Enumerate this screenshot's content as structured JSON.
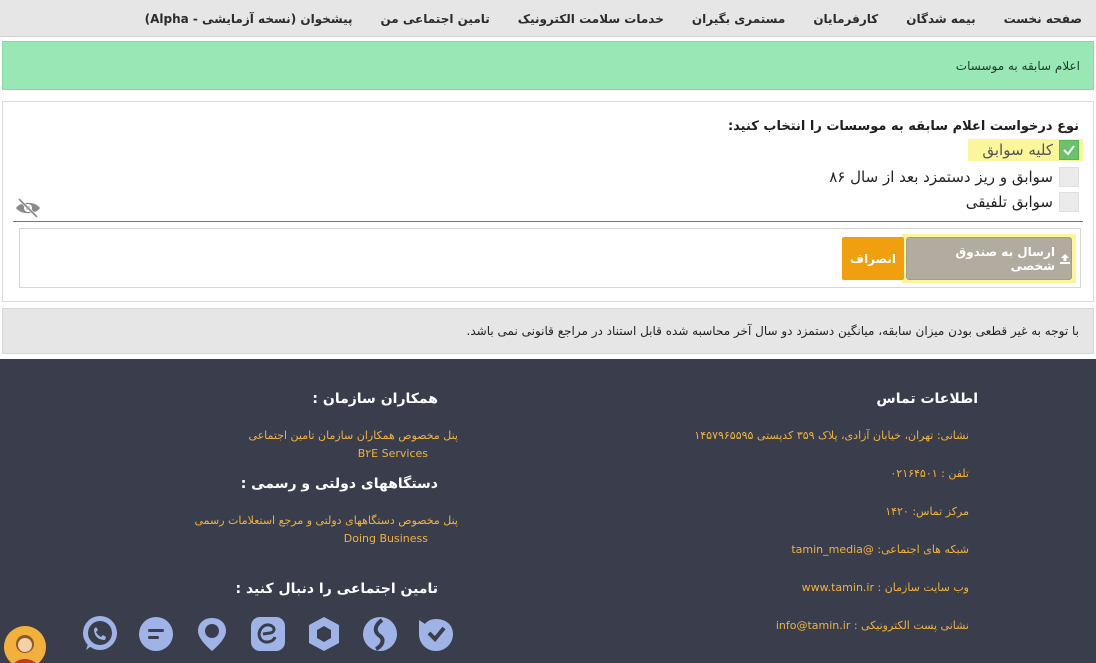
{
  "nav": {
    "items": [
      "صفحه نخست",
      "بیمه شدگان",
      "کارفرمایان",
      "مستمری بگیران",
      "خدمات سلامت الکترونیک",
      "تامین اجتماعی من",
      "پیشخوان (نسخه آزمایشی - Alpha)"
    ]
  },
  "banner": {
    "title": "اعلام سابقه به موسسات"
  },
  "form": {
    "question": "نوع درخواست اعلام سابقه به موسسات را انتخاب کنید:",
    "options": [
      {
        "label": "کلیه سوابق",
        "checked": true
      },
      {
        "label": "سوابق و ریز دستمزد بعد از سال ۸۶",
        "checked": false
      },
      {
        "label": "سوابق تلفیقی",
        "checked": false
      }
    ],
    "send_label": "ارسال به صندوق شخصی",
    "cancel_label": "انصراف"
  },
  "notice": {
    "text": "با توجه به غیر قطعی بودن میزان سابقه، میانگین دستمزد دو سال آخر محاسبه شده قابل استناد در مراجع قانونی نمی باشد."
  },
  "footer": {
    "contact_title": "اطلاعات تماس",
    "contact": {
      "address": "نشانی: تهران، خیابان آزادی، پلاک ۳۵۹ کدپستی ۱۴۵۷۹۶۵۵۹۵",
      "phone": "تلفن : ۰۲۱۶۴۵۰۱",
      "call_center": "مرکز تماس: ۱۴۲۰",
      "social": "شبکه های اجتماعی: @tamin_media",
      "website": "وب سایت سازمان : www.tamin.ir",
      "email": "نشانی پست الکترونیکی : info@tamin.ir"
    },
    "partners_title": "همکاران سازمان :",
    "partners_line1": "پنل مخصوص همکاران سازمان تامین اجتماعی",
    "partners_line2": "B۲E Services",
    "gov_title": "دستگاههای دولتی و رسمی :",
    "gov_line1": "پنل مخصوص دستگاههای دولتی و مرجع استعلامات رسمی",
    "gov_line2": "Doing Business",
    "follow_title": "تامین اجتماعی را دنبال کنید :",
    "social_icons": [
      "whatsapp-icon",
      "chat-icon",
      "map-pin-icon",
      "eitaa-icon",
      "hexagon-icon",
      "soroush-icon",
      "bale-icon"
    ]
  },
  "colors": {
    "nav_bg": "#e6e6e6",
    "banner_bg": "#98e7b5",
    "highlight": "#fbf59c",
    "check_green": "#6cc26c",
    "send_bg": "#b1aba0",
    "cancel_bg": "#f0a00e",
    "footer_bg": "#3a3e4c",
    "footer_link": "#f0b23e",
    "social_icon": "#9fb3e6"
  }
}
